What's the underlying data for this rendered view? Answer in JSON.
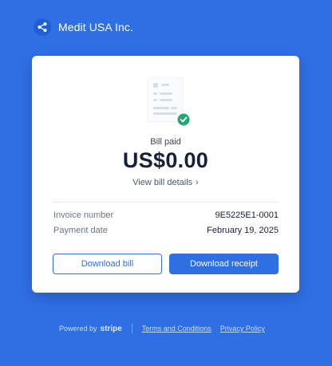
{
  "header": {
    "merchant_name": "Medit USA Inc.",
    "logo_icon": "share-nodes-icon"
  },
  "colors": {
    "background": "#2f6fe4",
    "accent": "#2f6fe4",
    "success": "#1fa672"
  },
  "card": {
    "illustration_icon": "paid-invoice-check-icon",
    "status": "Bill paid",
    "amount": "US$0.00",
    "view_details": "View bill details",
    "details": [
      {
        "label": "Invoice number",
        "value": "9E5225E1-0001"
      },
      {
        "label": "Payment date",
        "value": "February 19, 2025"
      }
    ],
    "buttons": {
      "download_bill": "Download bill",
      "download_receipt": "Download receipt"
    }
  },
  "footer": {
    "powered_by": "Powered by",
    "brand": "stripe",
    "links": [
      "Terms and Conditions",
      "Privacy Policy"
    ]
  }
}
